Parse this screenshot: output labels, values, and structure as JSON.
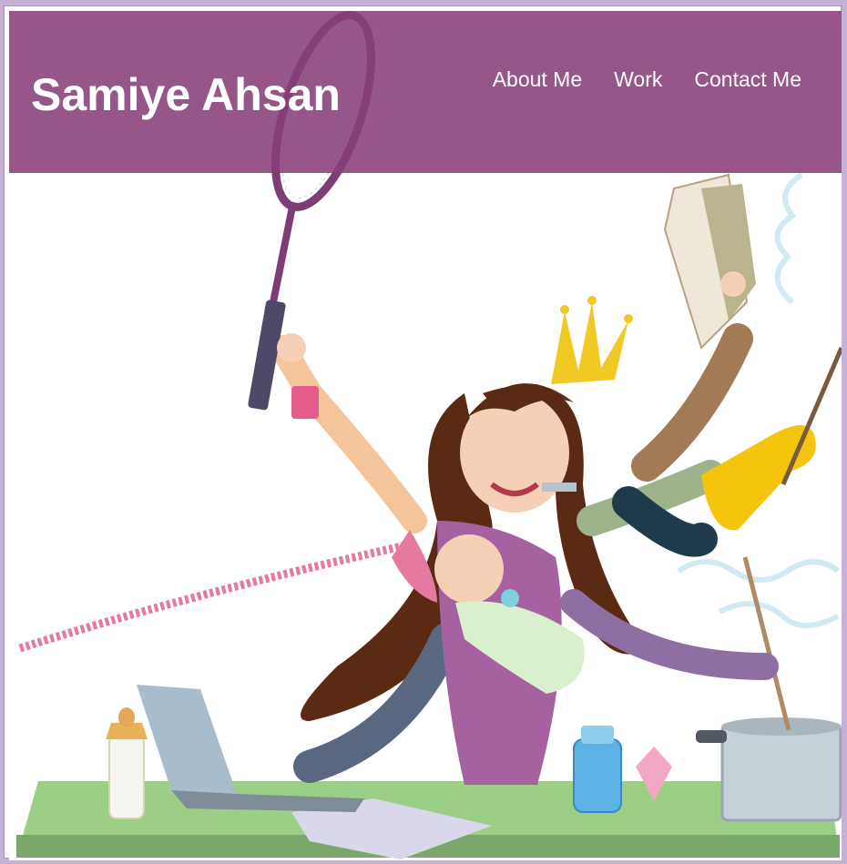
{
  "header": {
    "site_title": "Samiye Ahsan",
    "nav": [
      {
        "label": "About Me"
      },
      {
        "label": "Work"
      },
      {
        "label": "Contact Me"
      }
    ]
  },
  "hero": {
    "illustration": "busy-multitasking-mother-illustration"
  },
  "colors": {
    "header_bg": "#8a4a7c",
    "page_border": "#c5b1d3",
    "nav_text": "#ffffff"
  }
}
